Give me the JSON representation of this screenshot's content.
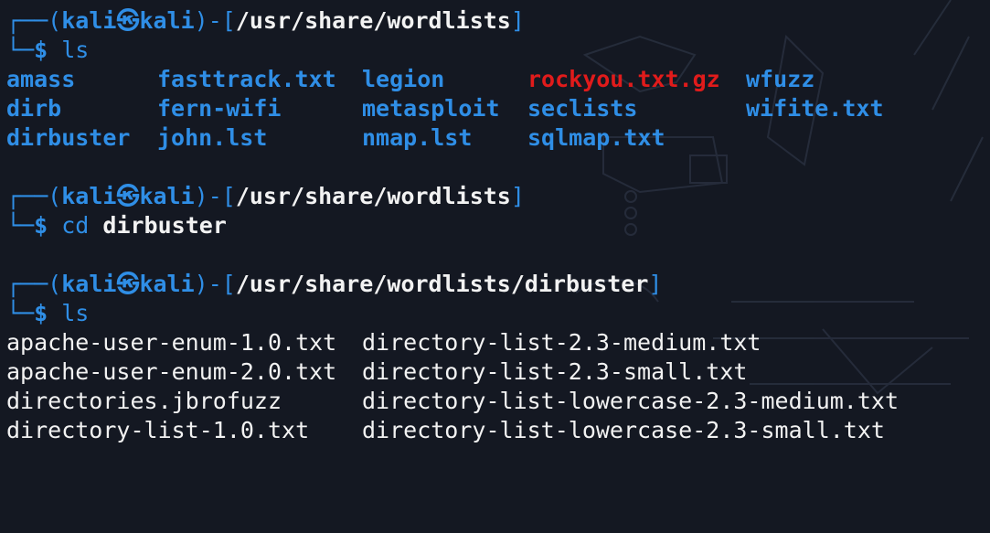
{
  "prompts": [
    {
      "user": "kali",
      "at": "㉿",
      "host": "kali",
      "path": "/usr/share/wordlists",
      "dollar": "$",
      "command": "ls",
      "argument": ""
    },
    {
      "user": "kali",
      "at": "㉿",
      "host": "kali",
      "path": "/usr/share/wordlists",
      "dollar": "$",
      "command": "cd",
      "argument": "dirbuster"
    },
    {
      "user": "kali",
      "at": "㉿",
      "host": "kali",
      "path": "/usr/share/wordlists/dirbuster",
      "dollar": "$",
      "command": "ls",
      "argument": ""
    }
  ],
  "frame": {
    "top_left": "┌──(",
    "mid": ")-[",
    "end": "]",
    "bottom_left": "└─"
  },
  "listing1": [
    [
      "amass",
      "fasttrack.txt",
      "legion",
      "rockyou.txt.gz",
      "wfuzz"
    ],
    [
      "dirb",
      "fern-wifi",
      "metasploit",
      "seclists",
      "wifite.txt"
    ],
    [
      "dirbuster",
      "john.lst",
      "nmap.lst",
      "sqlmap.txt",
      ""
    ]
  ],
  "listing2": [
    [
      "apache-user-enum-1.0.txt",
      "directory-list-2.3-medium.txt"
    ],
    [
      "apache-user-enum-2.0.txt",
      "directory-list-2.3-small.txt"
    ],
    [
      "directories.jbrofuzz",
      "directory-list-lowercase-2.3-medium.txt"
    ],
    [
      "directory-list-1.0.txt",
      "directory-list-lowercase-2.3-small.txt"
    ]
  ],
  "colors": {
    "background": "#141822",
    "blue": "#2f8ee6",
    "red": "#e01b1b",
    "white": "#f2f2f2"
  }
}
